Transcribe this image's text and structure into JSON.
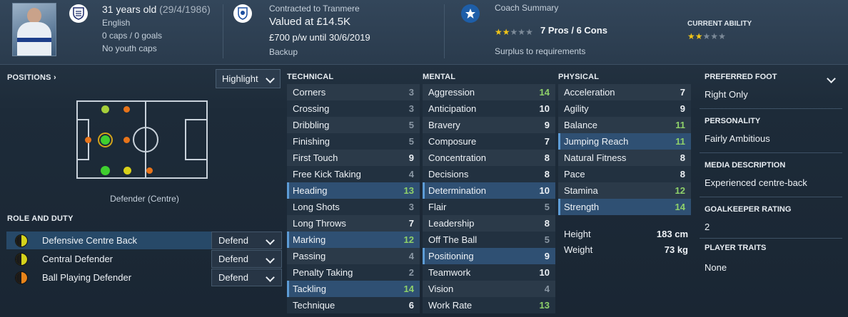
{
  "header": {
    "age": "31 years old",
    "dob": "(29/4/1986)",
    "nationality": "English",
    "caps": "0 caps / 0 goals",
    "youth_caps": "No youth caps",
    "contract": "Contracted to Tranmere",
    "value": "Valued at £14.5K",
    "wage": "£700 p/w until 30/6/2019",
    "squad_status": "Backup",
    "coach_summary_title": "Coach Summary",
    "coach_rating_stars": 2,
    "pros_cons": "7 Pros / 6 Cons",
    "coach_note": "Surplus to requirements",
    "current_ability_title": "CURRENT ABILITY",
    "current_ability_stars": 2
  },
  "positions": {
    "title": "POSITIONS",
    "highlight_label": "Highlight",
    "label": "Defender (Centre)"
  },
  "roles": {
    "title": "ROLE AND DUTY",
    "items": [
      {
        "name": "Defensive Centre Back",
        "duty": "Defend",
        "icon_color": "#d4d21c"
      },
      {
        "name": "Central Defender",
        "duty": "Defend",
        "icon_color": "#d4d21c"
      },
      {
        "name": "Ball Playing Defender",
        "duty": "Defend",
        "icon_color": "#e8841a"
      }
    ]
  },
  "technical": {
    "title": "TECHNICAL",
    "items": [
      {
        "name": "Corners",
        "value": "3"
      },
      {
        "name": "Crossing",
        "value": "3"
      },
      {
        "name": "Dribbling",
        "value": "5"
      },
      {
        "name": "Finishing",
        "value": "5"
      },
      {
        "name": "First Touch",
        "value": "9"
      },
      {
        "name": "Free Kick Taking",
        "value": "4"
      },
      {
        "name": "Heading",
        "value": "13"
      },
      {
        "name": "Long Shots",
        "value": "3"
      },
      {
        "name": "Long Throws",
        "value": "7"
      },
      {
        "name": "Marking",
        "value": "12"
      },
      {
        "name": "Passing",
        "value": "4"
      },
      {
        "name": "Penalty Taking",
        "value": "2"
      },
      {
        "name": "Tackling",
        "value": "14"
      },
      {
        "name": "Technique",
        "value": "6"
      }
    ]
  },
  "mental": {
    "title": "MENTAL",
    "items": [
      {
        "name": "Aggression",
        "value": "14"
      },
      {
        "name": "Anticipation",
        "value": "10"
      },
      {
        "name": "Bravery",
        "value": "9"
      },
      {
        "name": "Composure",
        "value": "7"
      },
      {
        "name": "Concentration",
        "value": "8"
      },
      {
        "name": "Decisions",
        "value": "8"
      },
      {
        "name": "Determination",
        "value": "10"
      },
      {
        "name": "Flair",
        "value": "5"
      },
      {
        "name": "Leadership",
        "value": "8"
      },
      {
        "name": "Off The Ball",
        "value": "5"
      },
      {
        "name": "Positioning",
        "value": "9"
      },
      {
        "name": "Teamwork",
        "value": "10"
      },
      {
        "name": "Vision",
        "value": "4"
      },
      {
        "name": "Work Rate",
        "value": "13"
      }
    ]
  },
  "physical": {
    "title": "PHYSICAL",
    "items": [
      {
        "name": "Acceleration",
        "value": "7"
      },
      {
        "name": "Agility",
        "value": "9"
      },
      {
        "name": "Balance",
        "value": "11"
      },
      {
        "name": "Jumping Reach",
        "value": "11"
      },
      {
        "name": "Natural Fitness",
        "value": "8"
      },
      {
        "name": "Pace",
        "value": "8"
      },
      {
        "name": "Stamina",
        "value": "12"
      },
      {
        "name": "Strength",
        "value": "14"
      }
    ],
    "height_label": "Height",
    "height": "183 cm",
    "weight_label": "Weight",
    "weight": "73 kg"
  },
  "right_panel": {
    "preferred_foot_title": "PREFERRED FOOT",
    "preferred_foot": "Right Only",
    "personality_title": "PERSONALITY",
    "personality": "Fairly Ambitious",
    "media_title": "MEDIA DESCRIPTION",
    "media": "Experienced centre-back",
    "gk_title": "GOALKEEPER RATING",
    "gk": "2",
    "traits_title": "PLAYER TRAITS",
    "traits": "None"
  },
  "colors": {
    "accent": "#2f5073",
    "attr_high": "#8fd16a",
    "attr_low": "#8a97a4",
    "star": "#f0c419"
  }
}
